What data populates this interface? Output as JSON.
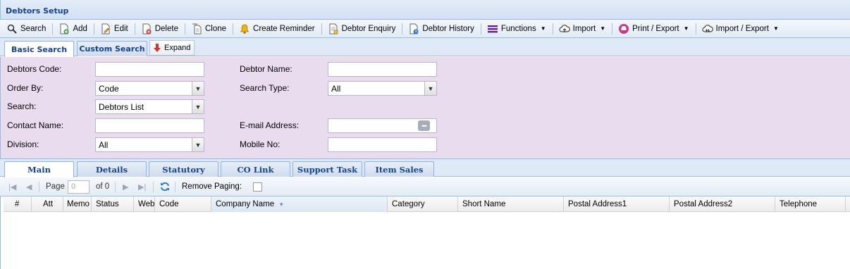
{
  "window": {
    "title": "Debtors Setup"
  },
  "toolbar": [
    {
      "label": "Search",
      "icon": "search-icon"
    },
    {
      "label": "Add",
      "icon": "add-icon"
    },
    {
      "label": "Edit",
      "icon": "edit-icon"
    },
    {
      "label": "Delete",
      "icon": "delete-icon"
    },
    {
      "label": "Clone",
      "icon": "clone-icon"
    },
    {
      "label": "Create Reminder",
      "icon": "bell-icon"
    },
    {
      "label": "Debtor Enquiry",
      "icon": "enquiry-icon"
    },
    {
      "label": "Debtor History",
      "icon": "history-icon"
    },
    {
      "label": "Functions",
      "icon": "functions-icon"
    },
    {
      "label": "Import",
      "icon": "cloud-upload-icon"
    },
    {
      "label": "Print / Export",
      "icon": "print-icon"
    },
    {
      "label": "Import / Export",
      "icon": "cloud-sync-icon"
    }
  ],
  "search_tabs": [
    "Basic Search",
    "Custom Search"
  ],
  "expand_label": "Expand",
  "form": {
    "debtors_code_label": "Debtors Code:",
    "debtors_code_value": "",
    "debtor_name_label": "Debtor Name:",
    "debtor_name_value": "",
    "order_by_label": "Order By:",
    "order_by_value": "Code",
    "search_type_label": "Search Type:",
    "search_type_value": "All",
    "search_label": "Search:",
    "search_value": "Debtors List",
    "contact_name_label": "Contact Name:",
    "contact_name_value": "",
    "email_label": "E-mail Address:",
    "email_value": "",
    "division_label": "Division:",
    "division_value": "All",
    "mobile_label": "Mobile No:",
    "mobile_value": ""
  },
  "detail_tabs": [
    "Main",
    "Details",
    "Statutory",
    "CO Link",
    "Support Task",
    "Item Sales"
  ],
  "pager": {
    "page_label": "Page",
    "page_value": "0",
    "of_label": "of 0",
    "remove_paging_label": "Remove Paging:"
  },
  "grid": {
    "columns": [
      "#",
      "Att",
      "Memo",
      "Status",
      "Webs",
      "Code",
      "Company Name",
      "Category",
      "Short Name",
      "Postal Address1",
      "Postal Address2",
      "Telephone"
    ],
    "sort_column": "Company Name"
  },
  "colors": {
    "header_text": "#15428b",
    "form_bg": "#e9dcee",
    "panel_border": "#99bbe8"
  }
}
